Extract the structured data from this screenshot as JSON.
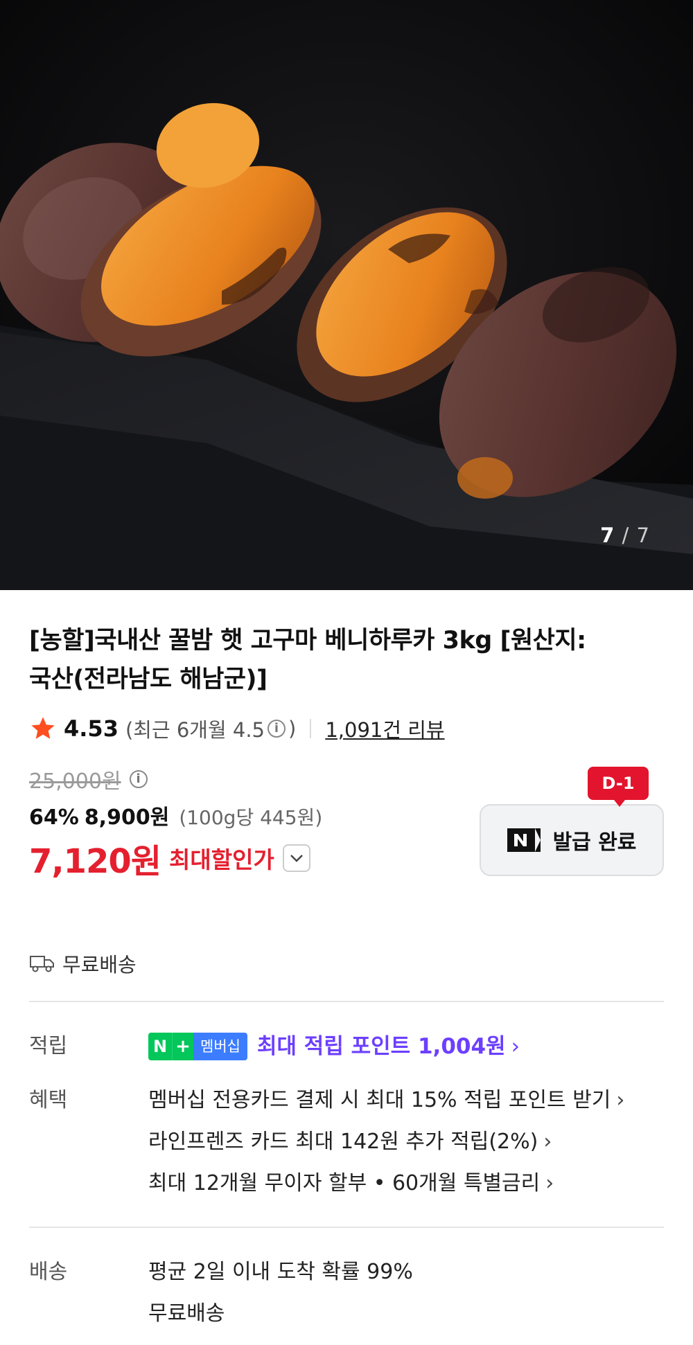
{
  "image": {
    "counter_current": "7",
    "counter_separator": "/",
    "counter_total": "7"
  },
  "product": {
    "title_line1": "[농할]국내산 꿀밤 햇 고구마 베니하루카 3kg [원산지:",
    "title_line2": "국산(전라남도 해남군)]",
    "rating": "4.53",
    "recent_rating_prefix": "(최근 6개월 4.5",
    "recent_rating_suffix": ")",
    "review_count": "1,091건 리뷰"
  },
  "price": {
    "original": "25,000원",
    "discount_rate": "64%",
    "discount_price": "8,900원",
    "unit_price": "(100g당 445원)",
    "final_price": "7,120원",
    "final_label": "최대할인가"
  },
  "coupon": {
    "dday": "D-1",
    "label": "발급 완료"
  },
  "shipping_badge": "무료배송",
  "points": {
    "label": "적립",
    "badge_n": "N",
    "badge_plus": "+",
    "badge_membership": "멤버십",
    "text": "최대 적립 포인트 1,004원"
  },
  "benefits": {
    "label": "혜택",
    "items": [
      "멤버십 전용카드 결제 시 최대 15% 적립 포인트 받기",
      "라인프렌즈 카드 최대 142원 추가 적립(2%)",
      "최대 12개월 무이자 할부 • 60개월 특별금리"
    ]
  },
  "delivery": {
    "label": "배송",
    "line1": "평균 2일 이내 도착 확률 99%",
    "line2": "무료배송"
  },
  "colors": {
    "sale_red": "#e4202f",
    "naver_green": "#03c75a",
    "points_purple": "#6c3fff"
  }
}
